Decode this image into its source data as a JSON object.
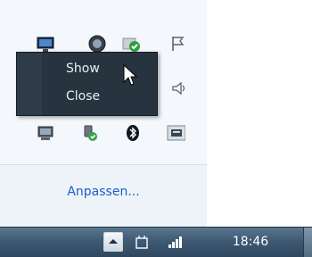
{
  "context_menu": {
    "items": [
      {
        "label": "Show"
      },
      {
        "label": "Close"
      }
    ]
  },
  "overflow": {
    "customize_label": "Anpassen...",
    "icons": [
      "network-monitor-icon",
      "app-globe-icon",
      "update-checkmark-icon",
      "action-center-flag-icon",
      "volume-icon",
      "display-icon",
      "usb-device-icon",
      "bluetooth-icon",
      "tray-app-icon"
    ]
  },
  "taskbar": {
    "clock": "18:46",
    "accent_color": "#1e5ec8",
    "menu_color": "#27333f"
  }
}
